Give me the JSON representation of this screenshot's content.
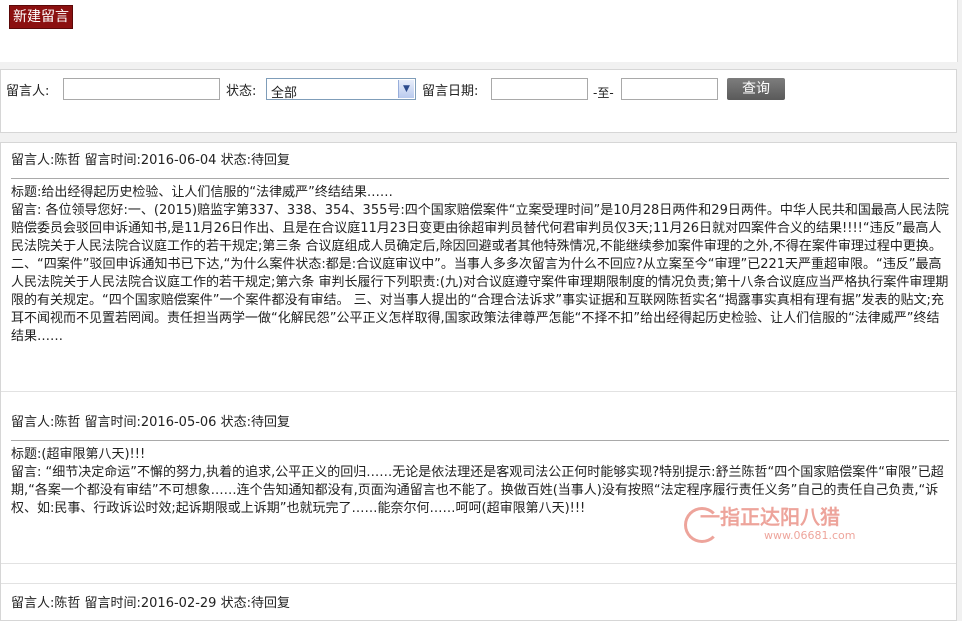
{
  "toolbar": {
    "new_label": "新建留言"
  },
  "search": {
    "person_label": "留言人:",
    "person_value": "",
    "status_label": "状态:",
    "status_value": "全部",
    "date_label": "留言日期:",
    "date_from": "",
    "to_label": "-至-",
    "date_to": "",
    "submit_label": "查询"
  },
  "messages": [
    {
      "meta": "留言人:陈哲  留言时间:2016-06-04  状态:待回复",
      "title": "标题:给出经得起历史检验、让人们信服的“法律威严”终结结果……",
      "content": "留言:  各位领导您好:一、(2015)赔监字第337、338、354、355号:四个国家赔偿案件“立案受理时间”是10月28日两件和29日两件。中华人民共和国最高人民法院赔偿委员会驳回申诉通知书,是11月26日作出、且是在合议庭11月23日变更由徐超审判员替代何君审判员仅3天;11月26日就对四案件合义的结果!!!!“违反”最高人民法院关于人民法院合议庭工作的若干规定;第三条  合议庭组成人员确定后,除因回避或者其他特殊情况,不能继续参加案件审理的之外,不得在案件审理过程中更换。 二、“四案件”驳回申诉通知书已下达,“为什么案件状态:都是:合议庭审议中”。当事人多多次留言为什么不回应?从立案至今“审理”已221天严重超审限。“违反”最高人民法院关于人民法院合议庭工作的若干规定;第六条  审判长履行下列职责:(九)对合议庭遵守案件审理期限制度的情况负责;第十八条合议庭应当严格执行案件审理期限的有关规定。“四个国家赔偿案件”一个案件都没有审结。 三、对当事人提出的“合理合法诉求”事实证据和互联网陈哲实名“揭露事实真相有理有据”发表的贴文;充耳不闻视而不见置若罔闻。责任担当两学一做“化解民怨”公平正义怎样取得,国家政策法律尊严怎能“不择不扣”给出经得起历史检验、让人们信服的“法律威严”终结结果……"
    },
    {
      "meta": "留言人:陈哲  留言时间:2016-05-06  状态:待回复",
      "title": "标题:(超审限第八天)!!!",
      "content": "留言:  “细节决定命运”不懈的努力,执着的追求,公平正义的回归……无论是依法理还是客观司法公正何时能够实现?特别提示:舒兰陈哲“四个国家赔偿案件“审限”已超期,“各案一个都没有审结”不可想象……连个告知通知都没有,页面沟通留言也不能了。换做百姓(当事人)没有按照“法定程序履行责任义务”自己的责任自己负责,“诉权、如:民事、行政诉讼时效;起诉期限或上诉期”也就玩完了……能奈尔何……呵呵(超审限第八天)!!!"
    },
    {
      "meta": "留言人:陈哲  留言时间:2016-02-29  状态:待回复"
    }
  ],
  "watermark": {
    "text": "一指正达阳八猎",
    "url": "www.06681.com"
  },
  "colors": {
    "new_button_bg": "#8b1010",
    "search_button_bg": "#6a6a6a",
    "rule": "#a9a9a9"
  }
}
